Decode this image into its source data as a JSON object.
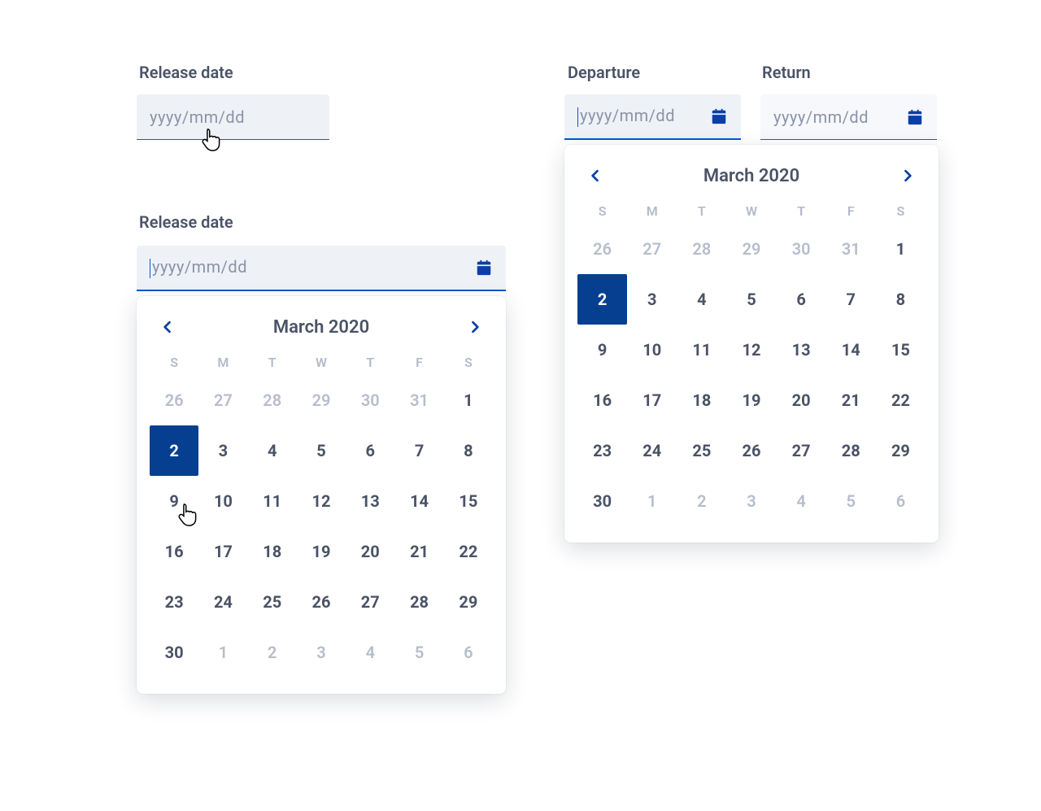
{
  "fields": {
    "release1": {
      "label": "Release date",
      "placeholder": "yyyy/mm/dd"
    },
    "release2": {
      "label": "Release date",
      "placeholder": "yyyy/mm/dd"
    },
    "departure": {
      "label": "Departure",
      "placeholder": "yyyy/mm/dd"
    },
    "return": {
      "label": "Return",
      "placeholder": "yyyy/mm/dd"
    }
  },
  "calendar": {
    "title": "March 2020",
    "dow": [
      "S",
      "M",
      "T",
      "W",
      "T",
      "F",
      "S"
    ],
    "leading": [
      26,
      27,
      28,
      29,
      30,
      31
    ],
    "days": [
      1,
      2,
      3,
      4,
      5,
      6,
      7,
      8,
      9,
      10,
      11,
      12,
      13,
      14,
      15,
      16,
      17,
      18,
      19,
      20,
      21,
      22,
      23,
      24,
      25,
      26,
      27,
      28,
      29,
      30
    ],
    "trailing": [
      1,
      2,
      3,
      4,
      5,
      6
    ],
    "selected": 2
  }
}
